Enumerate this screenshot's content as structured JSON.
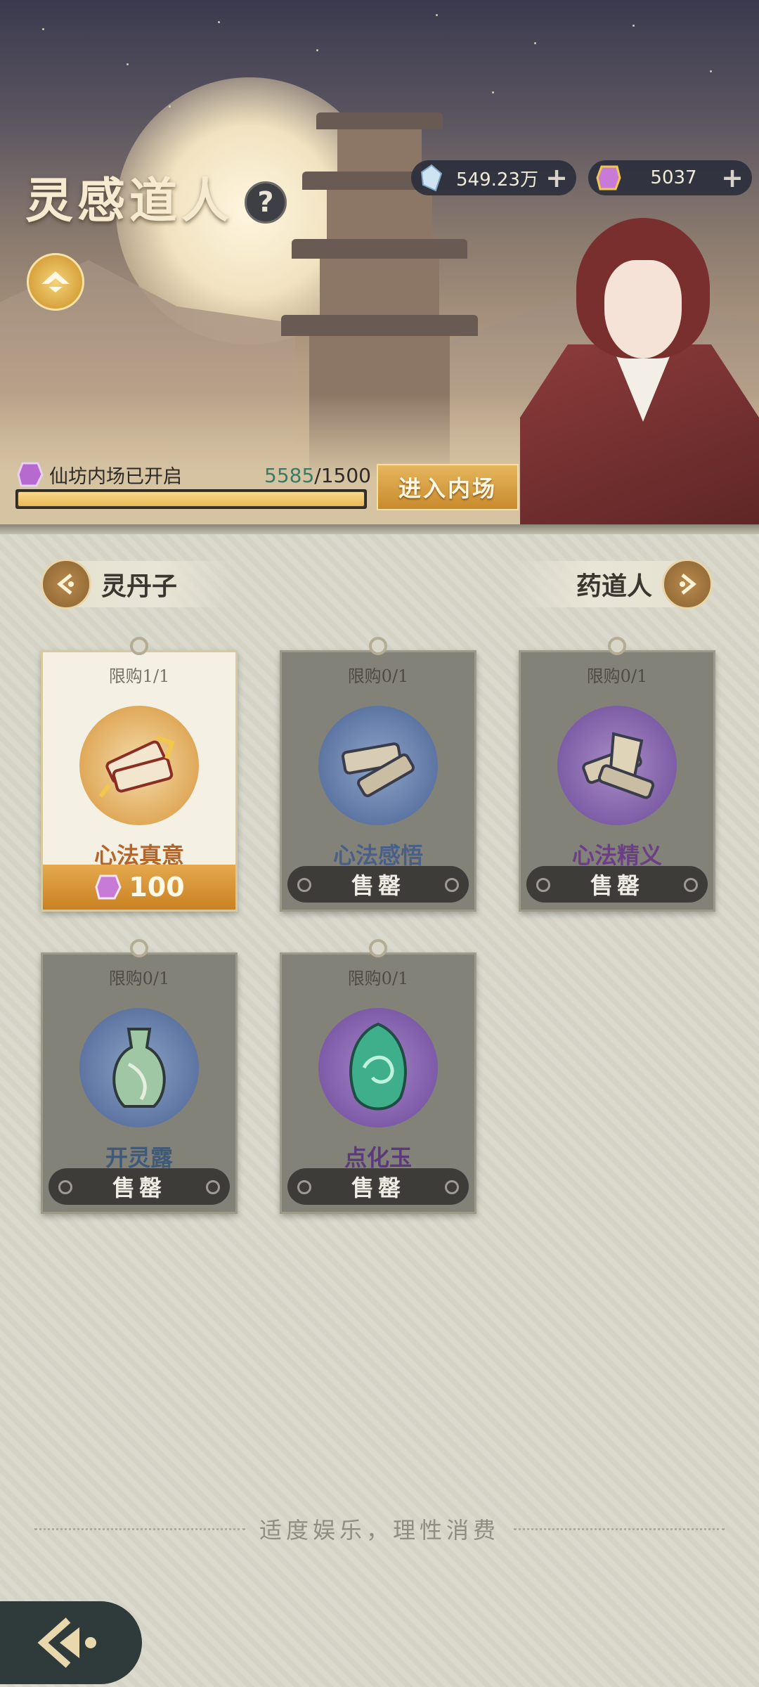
{
  "header": {
    "title": "灵感道人",
    "help_symbol": "?",
    "currencies": [
      {
        "icon": "spirit-crystal-icon",
        "amount": "549.23万",
        "plus": "+"
      },
      {
        "icon": "gold-token-icon",
        "amount": "5037",
        "plus": "+"
      }
    ],
    "progress": {
      "label": "仙坊内场已开启",
      "current": "5585",
      "separator": "/",
      "total": "1500",
      "fill_fraction": 1.0
    },
    "enter_button": "进入内场"
  },
  "nav": {
    "prev_label": "灵丹子",
    "next_label": "药道人"
  },
  "items": [
    {
      "limit": "限购1/1",
      "name": "心法真意",
      "price": "100",
      "sold_out": false,
      "name_color": "#b3662c",
      "icon": "scroll-bundle-icon"
    },
    {
      "limit": "限购0/1",
      "name": "心法感悟",
      "status": "售罄",
      "sold_out": true,
      "name_color": "#4a5f86",
      "icon": "scroll-blue-icon"
    },
    {
      "limit": "限购0/1",
      "name": "心法精义",
      "status": "售罄",
      "sold_out": true,
      "name_color": "#6a3f86",
      "icon": "scroll-purple-icon"
    },
    {
      "limit": "限购0/1",
      "name": "开灵露",
      "status": "售罄",
      "sold_out": true,
      "name_color": "#3f5a78",
      "icon": "jade-vase-icon"
    },
    {
      "limit": "限购0/1",
      "name": "点化玉",
      "status": "售罄",
      "sold_out": true,
      "name_color": "#5b3a7a",
      "icon": "jade-stone-icon"
    }
  ],
  "footer": {
    "note": "适度娱乐，理性消费"
  },
  "colors": {
    "accent_gold": "#e5a94d",
    "progress_current": "#3c7a64"
  }
}
